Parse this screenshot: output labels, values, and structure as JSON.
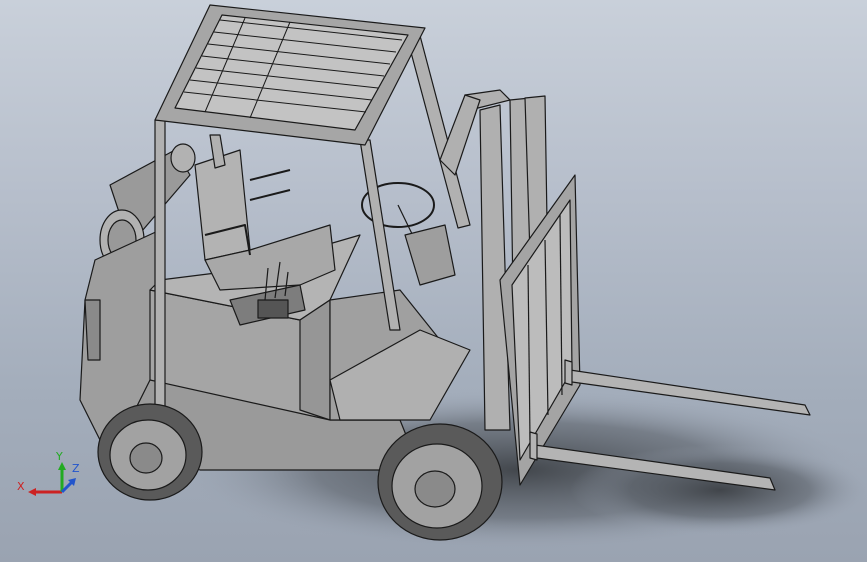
{
  "viewport": {
    "background_top": "#c9d0da",
    "background_bottom": "#9aa3b1",
    "model_fill": "#a9a9a9",
    "model_shade": "#8f8f8f",
    "edge_color": "#1a1a1a",
    "shadow_color": "#3e4247"
  },
  "triad": {
    "x_label": "X",
    "y_label": "Y",
    "z_label": "Z",
    "x_color": "#cc2222",
    "y_color": "#22aa22",
    "z_color": "#2255cc"
  }
}
